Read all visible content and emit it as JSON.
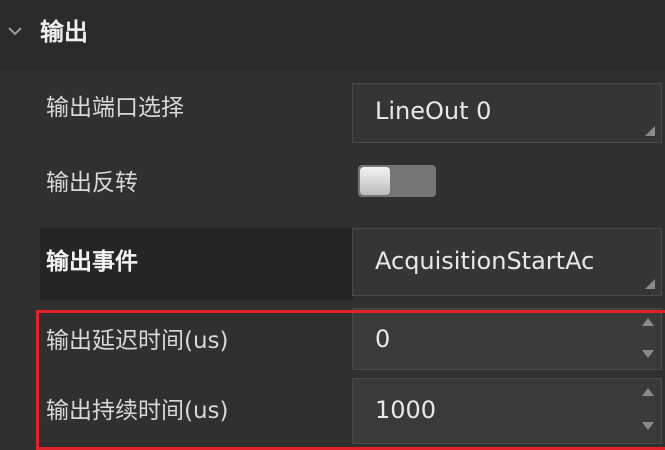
{
  "section": {
    "title": "输出",
    "chevron_icon": "chevron-down-icon"
  },
  "rows": {
    "output_port": {
      "label": "输出端口选择",
      "value": "LineOut 0"
    },
    "output_invert": {
      "label": "输出反转",
      "state": "off"
    },
    "output_event": {
      "label": "输出事件",
      "value": "AcquisitionStartAc"
    },
    "output_delay": {
      "label": "输出延迟时间(us)",
      "value": "0"
    },
    "output_duration": {
      "label": "输出持续时间(us)",
      "value": "1000"
    }
  },
  "colors": {
    "highlight_border": "#e0222a",
    "panel_bg": "#303030",
    "field_bg": "#353535"
  }
}
